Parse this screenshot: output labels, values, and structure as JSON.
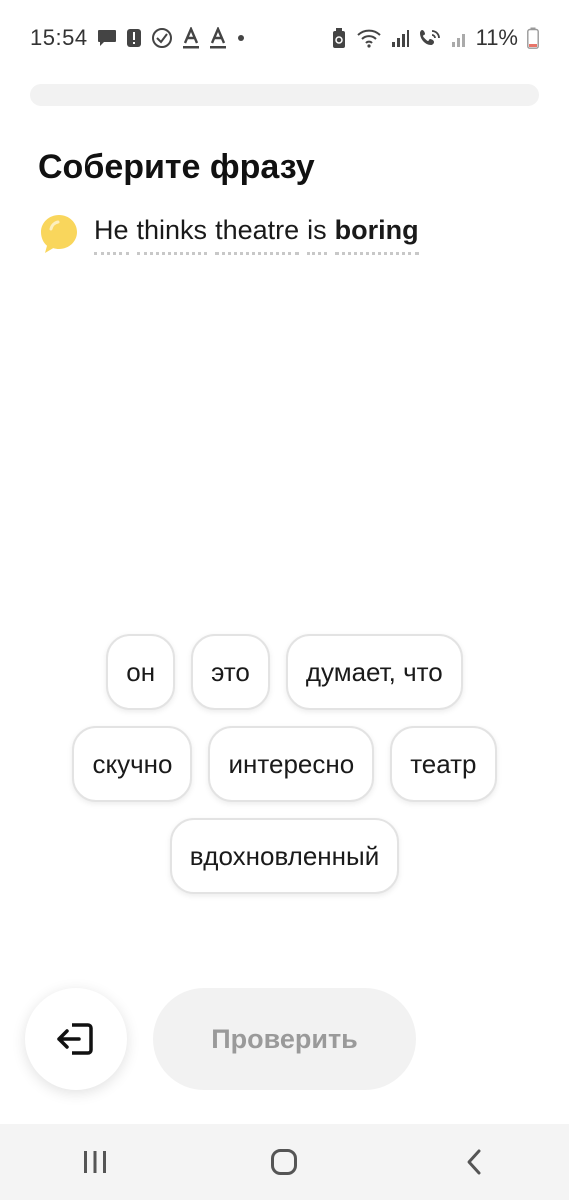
{
  "status_bar": {
    "time": "15:54",
    "battery_percent": "11%",
    "icons_left": [
      "message-icon",
      "alert-icon",
      "check-circle-icon",
      "text-a-icon",
      "text-a-icon",
      "dot-icon"
    ],
    "icons_right": [
      "battery-saver-icon",
      "wifi-icon",
      "signal-icon",
      "wifi-call-icon",
      "signal-icon",
      "battery-icon"
    ]
  },
  "progress": {
    "value": 0
  },
  "page": {
    "title": "Соберите фразу"
  },
  "phrase": {
    "words": [
      "He",
      "thinks",
      "theatre",
      "is",
      "boring"
    ],
    "emphasized": "boring",
    "bubble_color": "#F9D65C"
  },
  "chips": {
    "row1": [
      "он",
      "это",
      "думает, что"
    ],
    "row2": [
      "скучно",
      "интересно",
      "театр"
    ],
    "row3": [
      "вдохновленный"
    ]
  },
  "actions": {
    "exit_icon": "exit-icon",
    "check_label": "Проверить"
  },
  "nav": {
    "icons": [
      "recent-apps-icon",
      "home-icon",
      "back-icon"
    ]
  },
  "colors": {
    "check_button_bg": "#F2F2F2",
    "check_button_text": "#9A9A9A",
    "chip_border": "#E3E3E3"
  }
}
